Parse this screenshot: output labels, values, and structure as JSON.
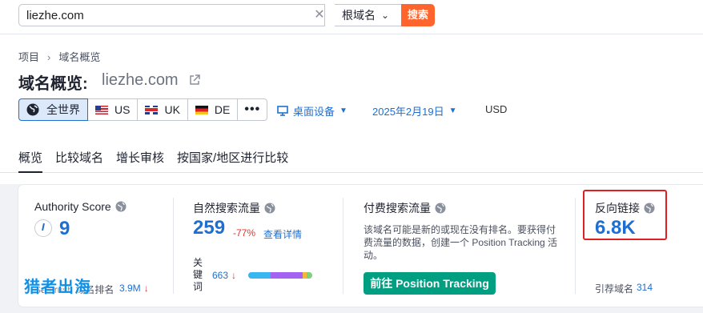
{
  "search": {
    "value": "liezhe.com",
    "clear_icon": "close-icon",
    "scope": "根域名",
    "button": "搜索"
  },
  "breadcrumb": [
    "项目",
    "域名概览"
  ],
  "header": {
    "title": "域名概览:",
    "domain": "liezhe.com"
  },
  "regions": [
    {
      "label": "全世界",
      "icon": "globe-icon",
      "selected": true
    },
    {
      "label": "US",
      "icon": "us-flag-icon"
    },
    {
      "label": "UK",
      "icon": "uk-flag-icon"
    },
    {
      "label": "DE",
      "icon": "de-flag-icon"
    },
    {
      "label": "•••",
      "icon": "more-icon"
    }
  ],
  "filters": {
    "device": "桌面设备",
    "date": "2025年2月19日",
    "currency": "USD"
  },
  "tabs": [
    "概览",
    "比较域名",
    "增长审核",
    "按国家/地区进行比较"
  ],
  "metrics": {
    "authority": {
      "title": "Authority Score",
      "value": "9",
      "rank_label": "Semrush 域名排名",
      "rank_value": "3.9M",
      "rank_trend": "↓"
    },
    "organic": {
      "title": "自然搜索流量",
      "value": "259",
      "change": "-77%",
      "link": "查看详情",
      "keywords_label": "关键词",
      "keywords_value": "663",
      "keywords_trend": "↓"
    },
    "paid": {
      "title": "付费搜索流量",
      "description": "该域名可能是新的或现在没有排名。要获得付费流量的数据，创建一个 Position Tracking 活动。",
      "button": "前往 Position Tracking"
    },
    "backlinks": {
      "title": "反向链接",
      "value": "6.8K",
      "ref_label": "引荐域名",
      "ref_value": "314"
    }
  },
  "keyword_distribution": [
    {
      "share": 0.35,
      "color": "#38b6f0"
    },
    {
      "share": 0.5,
      "color": "#a463f2"
    },
    {
      "share": 0.06,
      "color": "#f4b63f"
    },
    {
      "share": 0.09,
      "color": "#7ed27a"
    }
  ],
  "colors": {
    "accent": "#1f6fd0",
    "search_button": "#ff642d",
    "cta": "#009f81",
    "negative": "#e0342d",
    "highlight": "#e02020"
  },
  "watermark": "猎者出海"
}
